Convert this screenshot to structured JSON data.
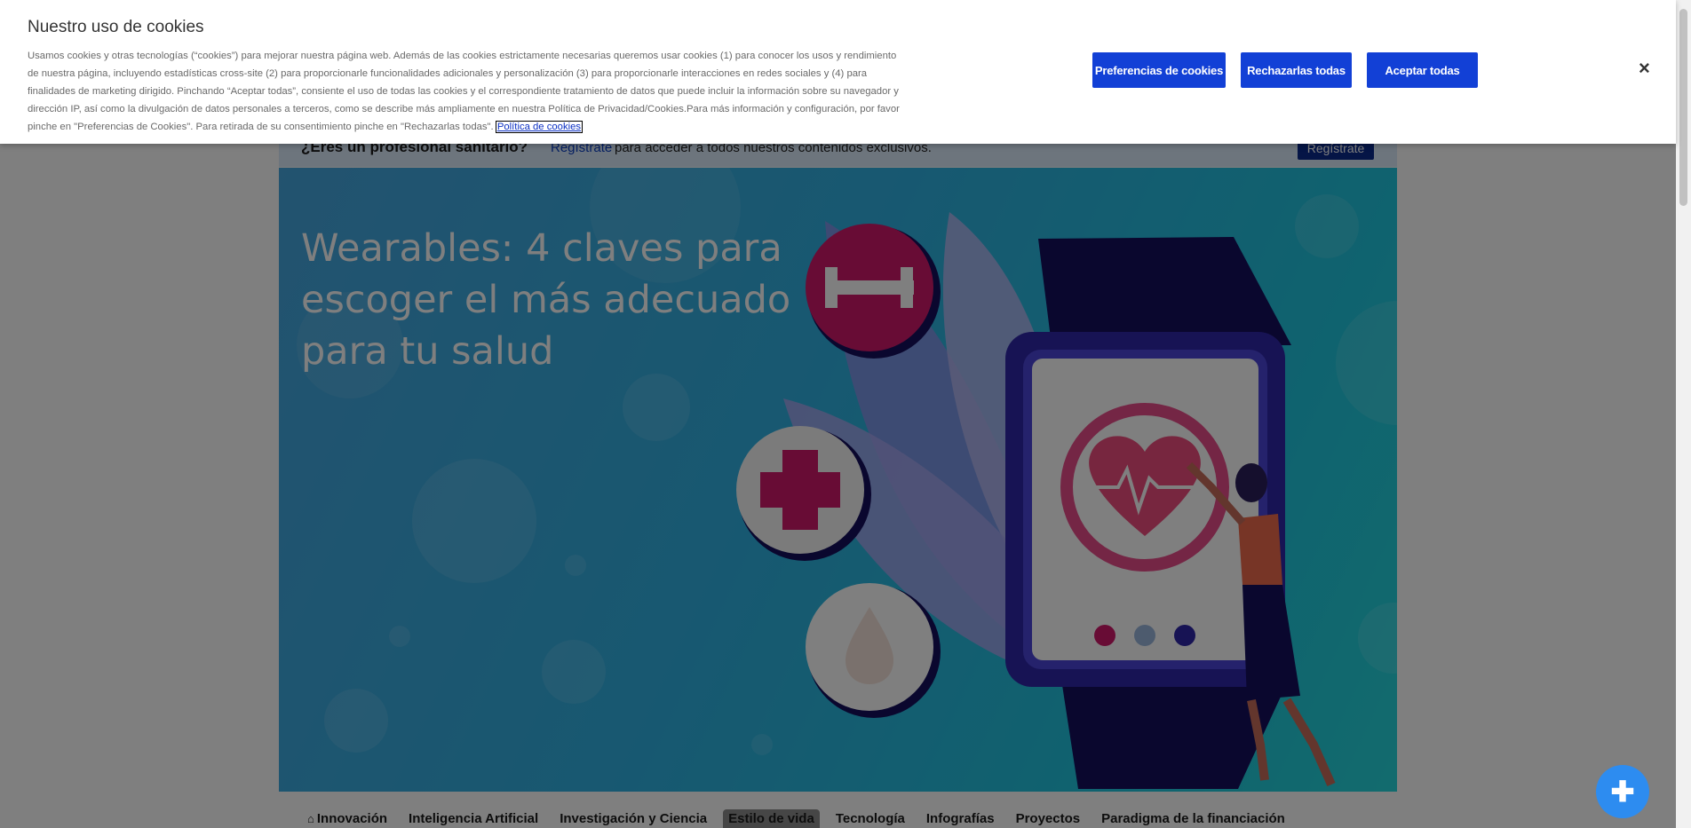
{
  "banner": {
    "question": "¿Eres un profesional sanitario?",
    "link": "Regístrate",
    "rest": "para acceder a todos nuestros contenidos exclusivos.",
    "button": "Regístrate"
  },
  "hero": {
    "title": "Wearables: 4 claves para escoger el más adecuado para tu salud"
  },
  "nav": {
    "items": [
      "Innovación",
      "Inteligencia Artificial",
      "Investigación y Ciencia",
      "Estilo de vida",
      "Tecnología",
      "Infografías",
      "Proyectos",
      "Paradigma de la financiación"
    ],
    "active": "Estilo de vida"
  },
  "cookies": {
    "title": "Nuestro uso de cookies",
    "text": "Usamos cookies y otras tecnologías (“cookies”) para mejorar nuestra página web. Además de las cookies estrictamente necesarias queremos usar cookies (1) para conocer los usos y rendimiento de nuestra página, incluyendo estadísticas cross-site (2) para proporcionarle funcionalidades adicionales y personalización (3) para proporcionarle interacciones en redes sociales y (4) para finalidades de marketing dirigido. Pinchando “Aceptar todas”, consiente el uso de todas las cookies y el correspondiente tratamiento de datos que puede incluir la información sobre su navegador y dirección IP, así como la divulgación de datos personales a terceros, como se describe más ampliamente en nuestra Política de Privacidad/Cookies.Para más información y configuración, por favor pinche en \"Preferencias de Cookies\". Para retirada de su consentimiento pinche en \"Rechazarlas todas\".",
    "policy_link": "Política de cookies",
    "btn_prefs": "Preferencias de cookies",
    "btn_reject": "Rechazarlas todas",
    "btn_accept": "Aceptar todas",
    "close": "×"
  },
  "colors": {
    "primary_button": "#1240d6",
    "hero_bg": "#2fb1e2",
    "helper_button": "#2d8cf0"
  }
}
